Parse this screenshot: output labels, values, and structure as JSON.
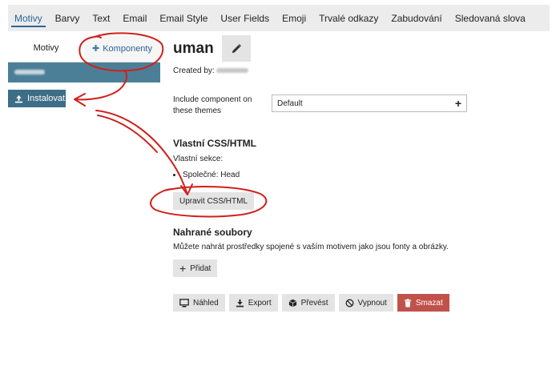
{
  "topnav": {
    "tabs": [
      "Motivy",
      "Barvy",
      "Text",
      "Email",
      "Email Style",
      "User Fields",
      "Emoji",
      "Trvalé odkazy",
      "Zabudování",
      "Sledovaná slova"
    ],
    "active": "Motivy"
  },
  "left": {
    "tab_themes": "Motivy",
    "tab_components": "Komponenty",
    "install_label": "Instalovat"
  },
  "theme": {
    "name": "uman",
    "created_by_label": "Created by:",
    "include_label": "Include component on these themes",
    "include_value": "Default"
  },
  "css_section": {
    "heading": "Vlastní CSS/HTML",
    "subheading": "Vlastní sekce:",
    "items": [
      "Společné: Head"
    ],
    "edit_label": "Upravit CSS/HTML"
  },
  "uploads": {
    "heading": "Nahrané soubory",
    "description": "Můžete nahrát prostředky spojené s vaším motivem jako jsou fonty a obrázky.",
    "add_label": "Přidat"
  },
  "actions": {
    "preview": "Náhled",
    "export": "Export",
    "convert": "Převést",
    "disable": "Vypnout",
    "delete": "Smazat"
  },
  "colors": {
    "accent": "#2a6496",
    "theme_bar": "#4b7f98",
    "install_button": "#3d6d87",
    "danger": "#c0524a",
    "annotation": "#d0201a"
  }
}
